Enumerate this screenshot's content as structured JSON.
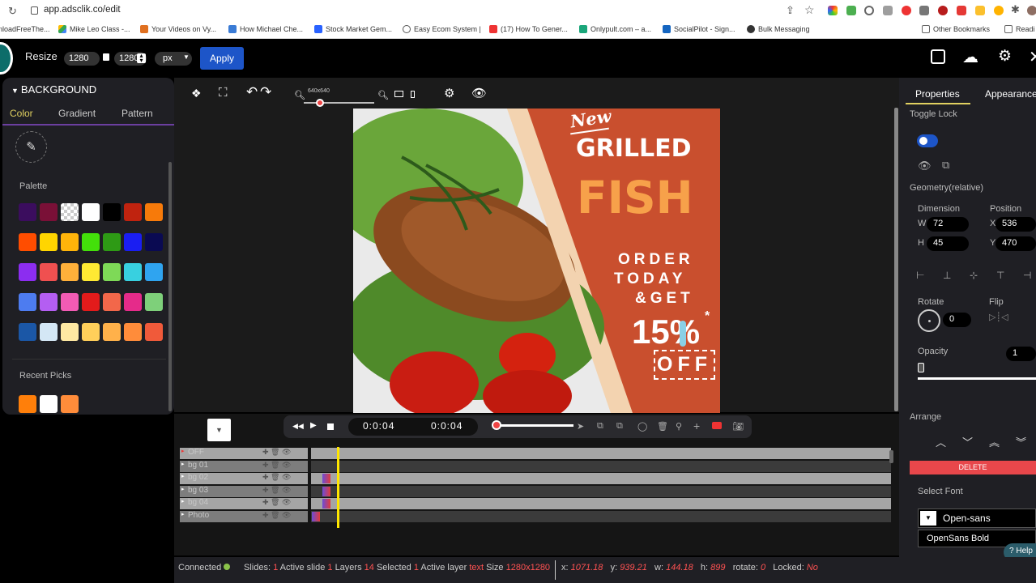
{
  "browser": {
    "url": "app.adsclik.co/edit",
    "bookmarks": [
      {
        "label": "nloadFreeThe...",
        "color": "#e55"
      },
      {
        "label": "Mike Leo Class -...",
        "color": "#4caf50"
      },
      {
        "label": "Your Videos on Vy...",
        "color": "#e07020"
      },
      {
        "label": "How Michael Che...",
        "color": "#3a7bd5"
      },
      {
        "label": "Stock Market Gem...",
        "color": "#2962ff"
      },
      {
        "label": "Easy Ecom System |",
        "color": "#444"
      },
      {
        "label": "(17) How To Gener...",
        "color": "#e33"
      },
      {
        "label": "Onlypult.com – a...",
        "color": "#1aa67a"
      },
      {
        "label": "SocialPilot - Sign...",
        "color": "#1565c0"
      },
      {
        "label": "Bulk Messaging",
        "color": "#333"
      },
      {
        "label": "Other Bookmarks",
        "color": "#888"
      },
      {
        "label": "Readi",
        "color": "#888"
      }
    ]
  },
  "topbar": {
    "resize_label": "Resize",
    "width_value": "1280",
    "height_value": "1280",
    "unit": "px",
    "apply_label": "Apply"
  },
  "leftpanel": {
    "title": "BACKGROUND",
    "tabs": [
      "Color",
      "Gradient",
      "Pattern"
    ],
    "palette_label": "Palette",
    "palette": [
      [
        "#3b0d5e",
        "#7a1037",
        "checker",
        "#ffffff",
        "#000000",
        "#c0230f",
        "#f77a0a"
      ],
      [
        "#ff4d00",
        "#ffd500",
        "#ffb40a",
        "#43e00a",
        "#2e9a15",
        "#1a1ef2",
        "#0a0a52"
      ],
      [
        "#8c2df0",
        "#f05050",
        "#ffb03a",
        "#ffe933",
        "#7ed957",
        "#38d0e0",
        "#2fa4f0"
      ],
      [
        "#4d7cf0",
        "#b45ef2",
        "#f25bb4",
        "#e31b1b",
        "#f2674a",
        "#e52b8a",
        "#7ed07a"
      ],
      [
        "#1b57a6",
        "#d4e7f5",
        "#ffe9a3",
        "#ffcf5a",
        "#ffb14a",
        "#ff8c3a",
        "#f05a3a"
      ]
    ],
    "recent_label": "Recent Picks",
    "recent": [
      "#ff7f0a",
      "#ffffff",
      "#ff8c3a"
    ]
  },
  "canvas": {
    "zoom_label": "640x640",
    "poster": {
      "new_text": "New",
      "grilled_text": "GRILLED",
      "fish_text": "FISH",
      "order_lines": [
        "ORDER",
        "TODAY",
        "&GET"
      ],
      "percent_text": "15%",
      "asterisk": "*",
      "off_text": "OFF"
    }
  },
  "timeline": {
    "time_current": "0:0:04",
    "time_total": "0:0:04",
    "rows": [
      {
        "label": "OFF",
        "marker_color": "#e33"
      },
      {
        "label": "bg 01",
        "marker_color": ""
      },
      {
        "label": "bg 02",
        "marker_color": ""
      },
      {
        "label": "bg 03",
        "marker_color": ""
      },
      {
        "label": "bg 04",
        "marker_color": ""
      },
      {
        "label": "Photo",
        "marker_color": ""
      }
    ]
  },
  "rightpanel": {
    "tabs": [
      "Properties",
      "Appearance"
    ],
    "toggle_lock": "Toggle Lock",
    "geometry_label": "Geometry(relative)",
    "dimension_label": "Dimension",
    "position_label": "Position",
    "w_label": "W",
    "w_value": "72",
    "h_label": "H",
    "h_value": "45",
    "x_label": "X",
    "x_value": "536",
    "y_label": "Y",
    "y_value": "470",
    "rotate_label": "Rotate",
    "rotate_value": "0",
    "flip_label": "Flip",
    "opacity_label": "Opacity",
    "opacity_value": "1",
    "arrange_label": "Arrange",
    "delete_label": "DELETE",
    "select_font_label": "Select Font",
    "font_value": "Open-sans",
    "font_option": "OpenSans Bold",
    "help_label": "Help"
  },
  "status": {
    "connected": "Connected",
    "slides_label": "Slides:",
    "slides_value": "1",
    "active_slide_label": "Active slide",
    "active_slide_value": "1",
    "layers_label": "Layers",
    "layers_value": "14",
    "selected_label": "Selected",
    "selected_value": "1",
    "active_layer_label": "Active layer",
    "active_layer_value": "text",
    "size_label": "Size",
    "size_value": "1280x1280",
    "x_label": "x:",
    "x_value": "1071.18",
    "y_label": "y:",
    "y_value": "939.21",
    "w_label": "w:",
    "w_value": "144.18",
    "h_label": "h:",
    "h_value": "899",
    "rotate_label": "rotate:",
    "rotate_value": "0",
    "locked_label": "Locked:",
    "locked_value": "No"
  }
}
